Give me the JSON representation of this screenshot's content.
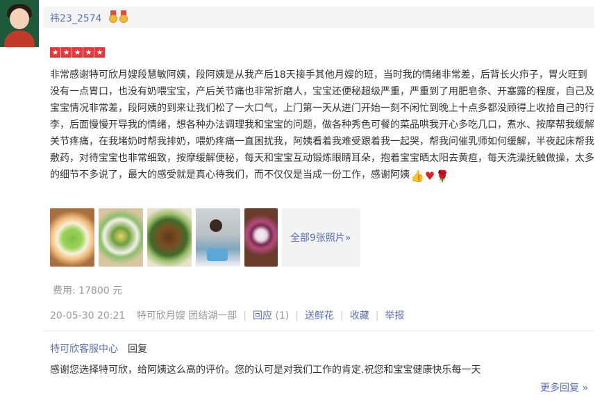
{
  "user": {
    "name": "祎23_2574",
    "medals": [
      "medal-icon",
      "medal-icon"
    ]
  },
  "rating": {
    "stars": 5,
    "max": 5
  },
  "review": {
    "text": "非常感谢特可欣月嫂段慧敏阿姨，段阿姨是从我产后18天接手其他月嫂的班，当时我的情绪非常差，后背长火疖子，胃火旺到没有一点胃口，也没有奶喂宝宝，产后关节痛也非常折磨人，宝宝还便秘超级严重，严重到了用肥皂条、开塞露的程度，自己及宝宝情况非常差，段阿姨的到来让我们松了一大口气，上门第一天从进门开始一刻不闲忙到晚上十点多都没顾得上收拾自己的行李，后面慢慢开导我的情绪，想各种办法调理我和宝宝的问题，做各种秀色可餐的菜品哄我开心多吃几口，煮水、按摩帮我缓解关节疼痛，在我堵奶时帮我排奶，喂奶疼痛一直困扰我，阿姨看着我难受跟着我一起哭，帮我问催乳师如何缓解，半夜起床帮我敷药，对待宝宝也非常细致，按摩缓解便秘，每天和宝宝互动锻炼眼睛耳朵，抱着宝宝晒太阳去黄疸，每天洗澡抚触做操，太多的细节不多说了，最大的感受就是真心待我们，而不仅仅是当成一份工作，感谢阿姨",
    "emojis": [
      "👍",
      "♥",
      "🌹"
    ]
  },
  "photos": {
    "items": [
      "photo-food-1",
      "photo-food-2",
      "photo-food-3",
      "photo-baby-cake",
      "photo-flower-plate"
    ],
    "more_label": "全部9张照片»"
  },
  "cost": "费用: 17800 元",
  "meta": {
    "date": "20-05-30 20:21",
    "service": "特可欣月嫂 团结湖一部",
    "reply_label": "回应",
    "reply_count": "(1)",
    "gift_label": "送鲜花",
    "favorite_label": "收藏",
    "report_label": "举报"
  },
  "reply": {
    "author": "特可欣客服中心",
    "action": "回复",
    "text": "感谢您选择特可欣，给阿姨这么高的评价。您的认可是对我们工作的肯定.祝您和宝宝健康快乐每一天",
    "more_label": "更多回复 »"
  },
  "colors": {
    "link": "#5a6dbd",
    "star": "#e4393c",
    "meta": "#999999"
  }
}
